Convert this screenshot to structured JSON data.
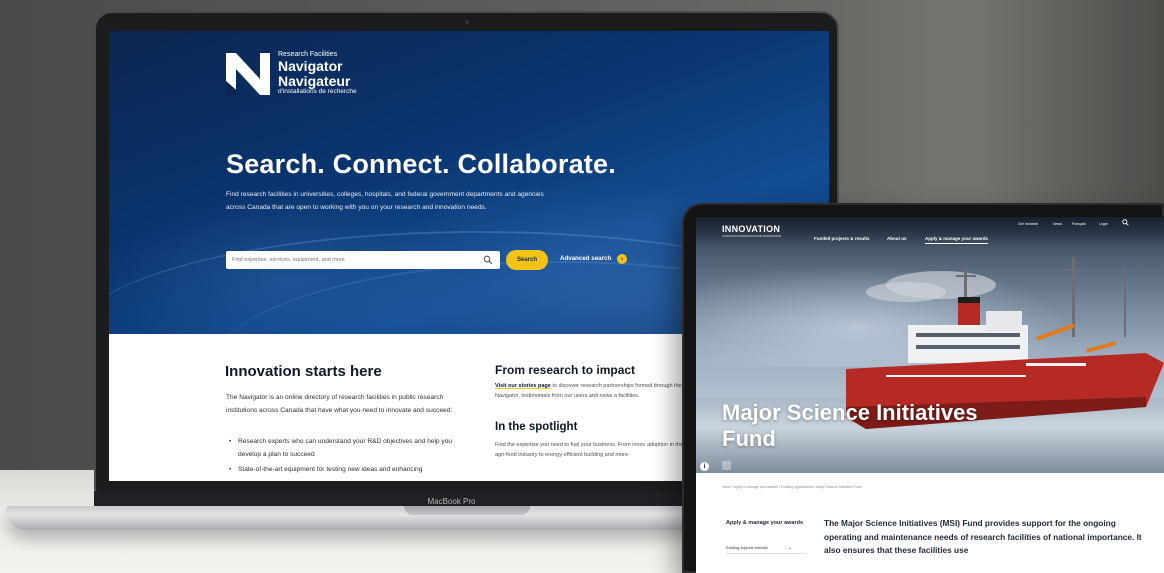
{
  "laptop": {
    "model_label": "MacBook Pro",
    "site": {
      "logo": {
        "small": "Research Facilities",
        "en": "Navigator",
        "fr": "Navigateur",
        "fr_sub": "d'installations de recherche"
      },
      "hero": {
        "title": "Search. Connect. Collaborate.",
        "description": "Find research facilities in universities, colleges, hospitals, and federal government departments and agencies across Canada that are open to working with you on your research and innovation needs."
      },
      "search": {
        "placeholder": "Find expertise, services, equipment, and more",
        "button_label": "Search",
        "advanced_label": "Advanced search"
      },
      "innovation": {
        "title": "Innovation starts here",
        "description": "The Navigator is an online directory of research facilities in public research institutions across Canada that have what you need to innovate and succeed:",
        "bullets": [
          "Research experts who can understand your R&D objectives and help you develop a plan to succeed",
          "State-of-the-art equipment for testing new ideas and enhancing"
        ]
      },
      "impact": {
        "title": "From research to impact",
        "link": "Visit our stories page",
        "description": " to discover research partnerships formed through the Navigator, testimonials from our users and news a facilities."
      },
      "spotlight": {
        "title": "In the spotlight",
        "description": "Find the expertise you need to fuel your business. From innov adoption in the agri-food industry to energy-efficient building and more."
      }
    }
  },
  "tablet": {
    "brand": "INNOVATION",
    "brand_sub": "CANADA FOUNDATION FOR INNOVATION",
    "nav": [
      "Funded projects & results",
      "About us",
      "Apply & manage your awards"
    ],
    "utility": [
      "Get Involved",
      "News",
      "Français",
      "Login"
    ],
    "hero_title": "Major Science Initiatives Fund",
    "breadcrumb": "Home  /  Apply & manage your awards  /  Funding opportunities  /  Major Science Initiatives Fund",
    "sidebar": {
      "link": "Apply & manage your awards",
      "sub": "Existing support vehicles"
    },
    "body": "The Major Science Initiatives (MSI) Fund provides support for the ongoing operating and maintenance needs of research facilities of national importance. It also ensures that these facilities use"
  },
  "colors": {
    "accent_yellow": "#f3c316",
    "hero_blue": "#0a3570",
    "ship_red": "#b52a24"
  }
}
